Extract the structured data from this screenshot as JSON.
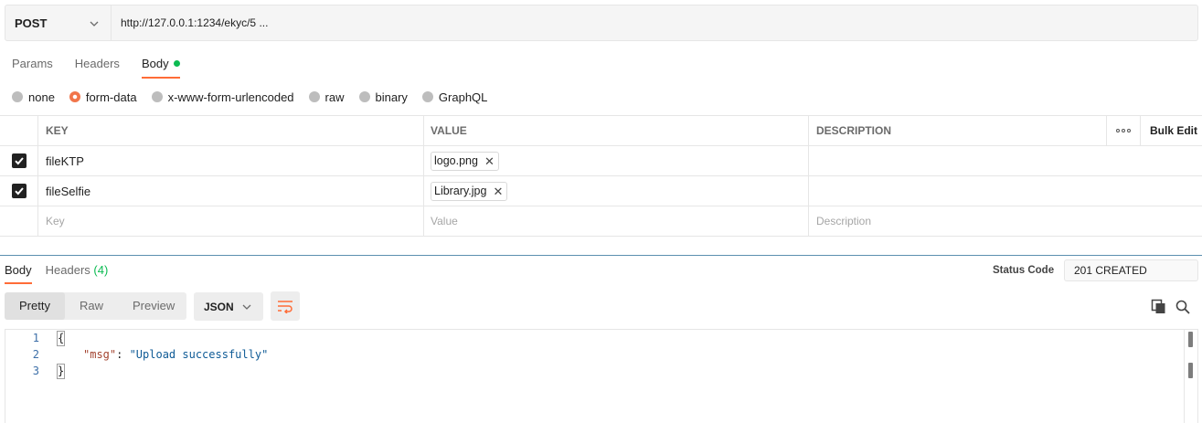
{
  "request": {
    "method": "POST",
    "url": "http://127.0.0.1:1234/ekyc/5 ..."
  },
  "request_tabs": [
    {
      "label": "Params",
      "active": false
    },
    {
      "label": "Headers",
      "active": false
    },
    {
      "label": "Body",
      "active": true
    }
  ],
  "body_types": [
    {
      "label": "none",
      "selected": false
    },
    {
      "label": "form-data",
      "selected": true
    },
    {
      "label": "x-www-form-urlencoded",
      "selected": false
    },
    {
      "label": "raw",
      "selected": false
    },
    {
      "label": "binary",
      "selected": false
    },
    {
      "label": "GraphQL",
      "selected": false
    }
  ],
  "params_table": {
    "headers": {
      "key": "KEY",
      "value": "VALUE",
      "description": "DESCRIPTION",
      "bulk_edit": "Bulk Edit"
    },
    "rows": [
      {
        "key": "fileKTP",
        "file": "logo.png",
        "checked": true
      },
      {
        "key": "fileSelfie",
        "file": "Library.jpg",
        "checked": true
      }
    ],
    "placeholders": {
      "key": "Key",
      "value": "Value",
      "description": "Description"
    }
  },
  "response": {
    "tabs": {
      "body": "Body",
      "headers": "Headers",
      "headers_count": "(4)"
    },
    "status_label": "Status Code",
    "status_value": "201 CREATED",
    "view_modes": [
      "Pretty",
      "Raw",
      "Preview"
    ],
    "format": "JSON",
    "code_lines": [
      {
        "num": "1",
        "text": "{"
      },
      {
        "num": "2",
        "key": "\"msg\"",
        "sep": ": ",
        "value": "\"Upload successfully\""
      },
      {
        "num": "3",
        "text": "}"
      }
    ]
  },
  "icons": {
    "method_dropdown": "chevron-down-icon",
    "more": "more-options-icon",
    "wrap": "wrap-lines-icon",
    "copy": "copy-icon",
    "search": "search-icon",
    "remove_file": "close-icon",
    "checkbox": "check-icon"
  },
  "colors": {
    "accent": "#ff6c37",
    "success": "#0cbb52"
  }
}
